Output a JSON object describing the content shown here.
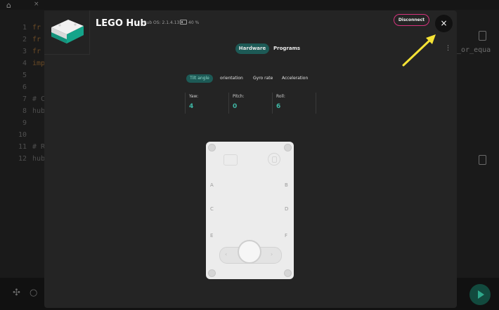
{
  "background": {
    "code_lines": [
      {
        "n": "1",
        "text": "fr"
      },
      {
        "n": "2",
        "text": "fr"
      },
      {
        "n": "3",
        "text": "fr"
      },
      {
        "n": "4",
        "text": "imp"
      },
      {
        "n": "5",
        "text": ""
      },
      {
        "n": "6",
        "text": ""
      },
      {
        "n": "7",
        "text": "# C"
      },
      {
        "n": "8",
        "text": "hub"
      },
      {
        "n": "9",
        "text": ""
      },
      {
        "n": "10",
        "text": ""
      },
      {
        "n": "11",
        "text": "# R"
      },
      {
        "n": "12",
        "text": "hub"
      }
    ],
    "right_text": "_or_equa",
    "icons": [
      "home-icon",
      "close-icon",
      "hub-device-icon",
      "settings-icon",
      "search-icon",
      "run-icon"
    ]
  },
  "modal": {
    "title": "LEGO Hub",
    "os_version": "Hub OS: 2.1.4.13",
    "battery_percent": "40 %",
    "battery_level": 0.4,
    "disconnect_label": "Disconnect",
    "close_icon": "×",
    "more_icon": "⋮",
    "tabs": [
      {
        "label": "Hardware",
        "active": true
      },
      {
        "label": "Programs",
        "active": false
      }
    ],
    "subtabs": [
      {
        "label": "Tilt angle",
        "active": true
      },
      {
        "label": "orientation",
        "active": false
      },
      {
        "label": "Gyro rate",
        "active": false
      },
      {
        "label": "Acceleration",
        "active": false
      }
    ],
    "readings": [
      {
        "label": "Yaw:",
        "value": "4"
      },
      {
        "label": "Pitch:",
        "value": "0"
      },
      {
        "label": "Roll:",
        "value": "6"
      }
    ],
    "hub": {
      "ports_left": [
        "A",
        "C",
        "E"
      ],
      "ports_right": [
        "B",
        "D",
        "F"
      ]
    }
  },
  "colors": {
    "accent": "#1d5a56",
    "value_teal": "#3fb6a4",
    "disconnect_border": "#d6337d",
    "annotation_arrow": "#f5e335"
  }
}
